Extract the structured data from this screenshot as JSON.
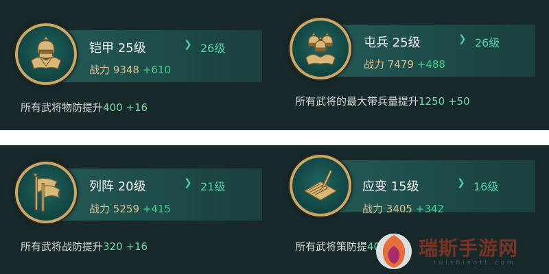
{
  "cards": [
    {
      "name": "铠甲 25级",
      "next_level": "26级",
      "power_label": "战力",
      "power_value": "9348",
      "power_increase": "+610",
      "desc_text": "所有武将物防提升",
      "desc_value": "400 +16",
      "icon": "armor-icon"
    },
    {
      "name": "屯兵 25级",
      "next_level": "26级",
      "power_label": "战力",
      "power_value": "7479",
      "power_increase": "+488",
      "desc_text": "所有武将的最大带兵量提升",
      "desc_value": "1250 +50",
      "icon": "troops-icon"
    },
    {
      "name": "列阵 20级",
      "next_level": "21级",
      "power_label": "战力",
      "power_value": "5259",
      "power_increase": "+415",
      "desc_text": "所有武将战防提升",
      "desc_value": "320 +16",
      "icon": "banner-icon"
    },
    {
      "name": "应变 15级",
      "next_level": "16级",
      "power_label": "战力",
      "power_value": "3405",
      "power_increase": "+342",
      "desc_text": "所有武将策防提",
      "desc_value": "40 +16",
      "icon": "scroll-brush-icon"
    }
  ],
  "watermark": {
    "text": "瑞斯手游网",
    "url": "ruishisoft.com",
    "icon": "flame-logo-icon"
  },
  "colors": {
    "panel_bg": "#18292b",
    "band": "#245a57",
    "gold": "#c9a768",
    "green": "#58d4a8"
  }
}
